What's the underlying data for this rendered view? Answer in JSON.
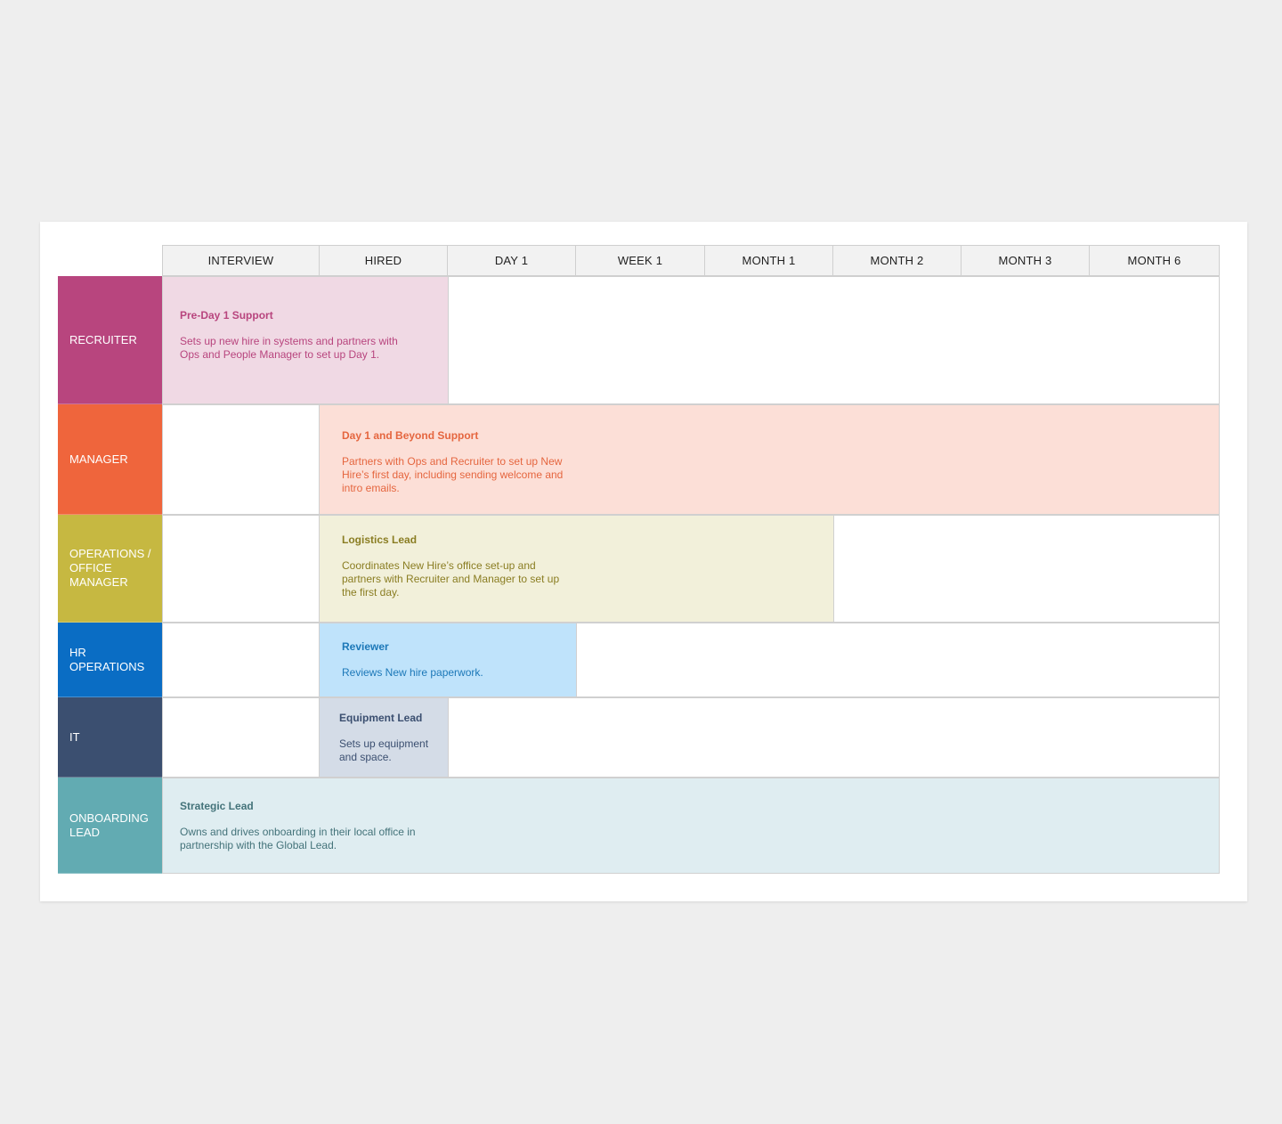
{
  "columns": [
    "INTERVIEW",
    "HIRED",
    "DAY 1",
    "WEEK 1",
    "MONTH 1",
    "MONTH 2",
    "MONTH 3",
    "MONTH 6"
  ],
  "rows": [
    {
      "label": "RECRUITER",
      "color": "#b8457e",
      "task": {
        "title": "Pre-Day 1 Support",
        "description": "Sets up new hire in systems and partners with Ops and People Manager to set up Day 1.",
        "start": "INTERVIEW",
        "end": "HIRED",
        "fill": "#f0d9e4",
        "text_color": "#b8457e"
      }
    },
    {
      "label": "MANAGER",
      "color": "#ef653c",
      "task": {
        "title": "Day 1 and Beyond Support",
        "description": "Partners with Ops and Recruiter to set up New Hire’s first day, including sending welcome and intro emails.",
        "start": "HIRED",
        "end": "MONTH 6",
        "fill": "#fcdfd7",
        "text_color": "#e5663f"
      }
    },
    {
      "label": "OPERATIONS / OFFICE MANAGER",
      "color": "#c6b841",
      "task": {
        "title": "Logistics Lead",
        "description": "Coordinates New Hire’s office set-up and partners with Recruiter and Manager to set up the first day.",
        "start": "HIRED",
        "end": "MONTH 1",
        "fill": "#f2f0da",
        "text_color": "#8a7d22"
      }
    },
    {
      "label": "HR OPERATIONS",
      "color": "#0a6dc4",
      "task": {
        "title": "Reviewer",
        "description": "Reviews New hire paperwork.",
        "start": "HIRED",
        "end": "DAY 1",
        "fill": "#bfe3fb",
        "text_color": "#1c78b8"
      }
    },
    {
      "label": "IT",
      "color": "#3b4f70",
      "task": {
        "title": "Equipment Lead",
        "description": "Sets up equipment and space.",
        "start": "HIRED",
        "end": "HIRED",
        "fill": "#d4dce7",
        "text_color": "#3b4f70"
      }
    },
    {
      "label": "ONBOARDING LEAD",
      "color": "#62abb2",
      "task": {
        "title": "Strategic Lead",
        "description": "Owns and drives onboarding in their local office in partnership with the Global Lead.",
        "start": "INTERVIEW",
        "end": "MONTH 6",
        "fill": "#dfedf1",
        "text_color": "#44737a"
      }
    }
  ]
}
